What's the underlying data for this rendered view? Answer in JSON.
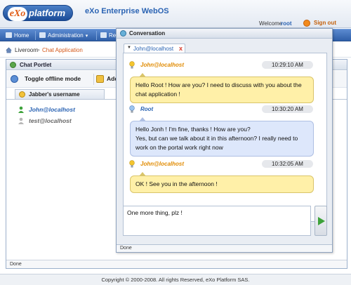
{
  "header": {
    "logo_text": "eXo platform",
    "app_title": "eXo Enterprise WebOS",
    "welcome_label": "Welcome",
    "username": "root",
    "signout_label": "Sign out"
  },
  "nav": {
    "items": [
      {
        "label": "Home",
        "icon": "home-icon"
      },
      {
        "label": "Administration",
        "icon": "admin-icon"
      },
      {
        "label": "Re",
        "icon": "resources-icon"
      }
    ]
  },
  "breadcrumb": {
    "items": [
      "Liveroom",
      "Chat Application"
    ],
    "separator": ">"
  },
  "chat_portlet": {
    "title": "Chat Portlet",
    "toggle_offline_label": "Toggle offline mode",
    "add_label": "Add",
    "contacts_header": "Jabber's username",
    "contacts": [
      {
        "name": "John@localhost",
        "status": "online",
        "color": "#2a63b3"
      },
      {
        "name": "test@localhost",
        "status": "offline",
        "color": "#666666"
      }
    ],
    "status": "Done"
  },
  "conversation": {
    "title": "Conversation",
    "tab_label": "John@localhost",
    "tab_close": "x",
    "messages": [
      {
        "sender": "John@localhost",
        "time": "10:29:10 AM",
        "style": "yellow",
        "sender_color": "#e08a00",
        "lines": [
          "Hello Root ! How are you? I need to discuss with you about the",
          "chat application !"
        ]
      },
      {
        "sender": "Root",
        "time": "10:30:20 AM",
        "style": "blue",
        "sender_color": "#2a63b3",
        "lines": [
          "Hello Jonh ! I'm fine, thanks ! How are you?",
          "Yes, but can we talk about it in this afternoon? I really need to",
          "work on the portal work right now"
        ]
      },
      {
        "sender": "John@localhost",
        "time": "10:32:05 AM",
        "style": "yellow",
        "sender_color": "#e08a00",
        "lines": [
          "OK ! See you in the afternoon !"
        ]
      }
    ],
    "input_value": "One more thing, plz !",
    "send_icon": "send-arrow-icon",
    "status": "Done"
  },
  "footer": {
    "text": "Copyright © 2000-2008. All rights Reserved, eXo Platform SAS."
  }
}
